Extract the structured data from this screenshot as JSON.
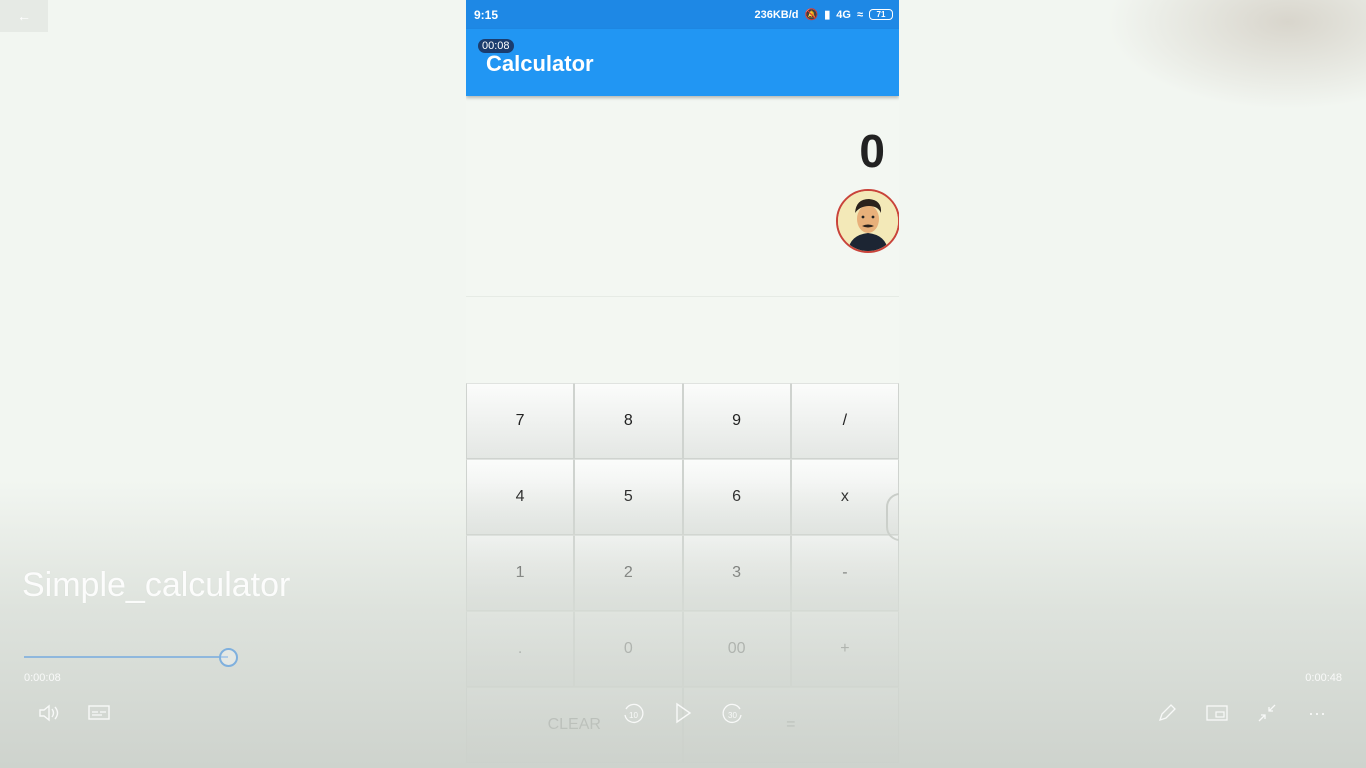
{
  "status_bar": {
    "time": "9:15",
    "network_speed": "236KB/d",
    "network_type": "4G",
    "battery": "71"
  },
  "player_overlay": {
    "timer_badge": "00:08"
  },
  "app": {
    "title": "Calculator",
    "display_value": "0"
  },
  "keypad": {
    "rows": [
      [
        "7",
        "8",
        "9",
        "/"
      ],
      [
        "4",
        "5",
        "6",
        "x"
      ],
      [
        "1",
        "2",
        "3",
        "-"
      ],
      [
        ".",
        "0",
        "00",
        "+"
      ],
      [
        "CLEAR",
        "="
      ]
    ]
  },
  "player": {
    "video_title": "Simple_calculator",
    "current_time": "0:00:08",
    "total_time": "0:00:48",
    "progress_fraction": 0.17,
    "accent_color": "#7fb0de"
  },
  "icons": {
    "back": "arrow-left-icon",
    "volume": "volume-icon",
    "subtitles": "subtitles-icon",
    "rewind": "rewind-10-icon",
    "play": "play-icon",
    "forward": "forward-30-icon",
    "edit": "pencil-icon",
    "miniplayer": "miniplayer-icon",
    "exit_fullscreen": "exit-fullscreen-icon",
    "more": "more-icon"
  }
}
